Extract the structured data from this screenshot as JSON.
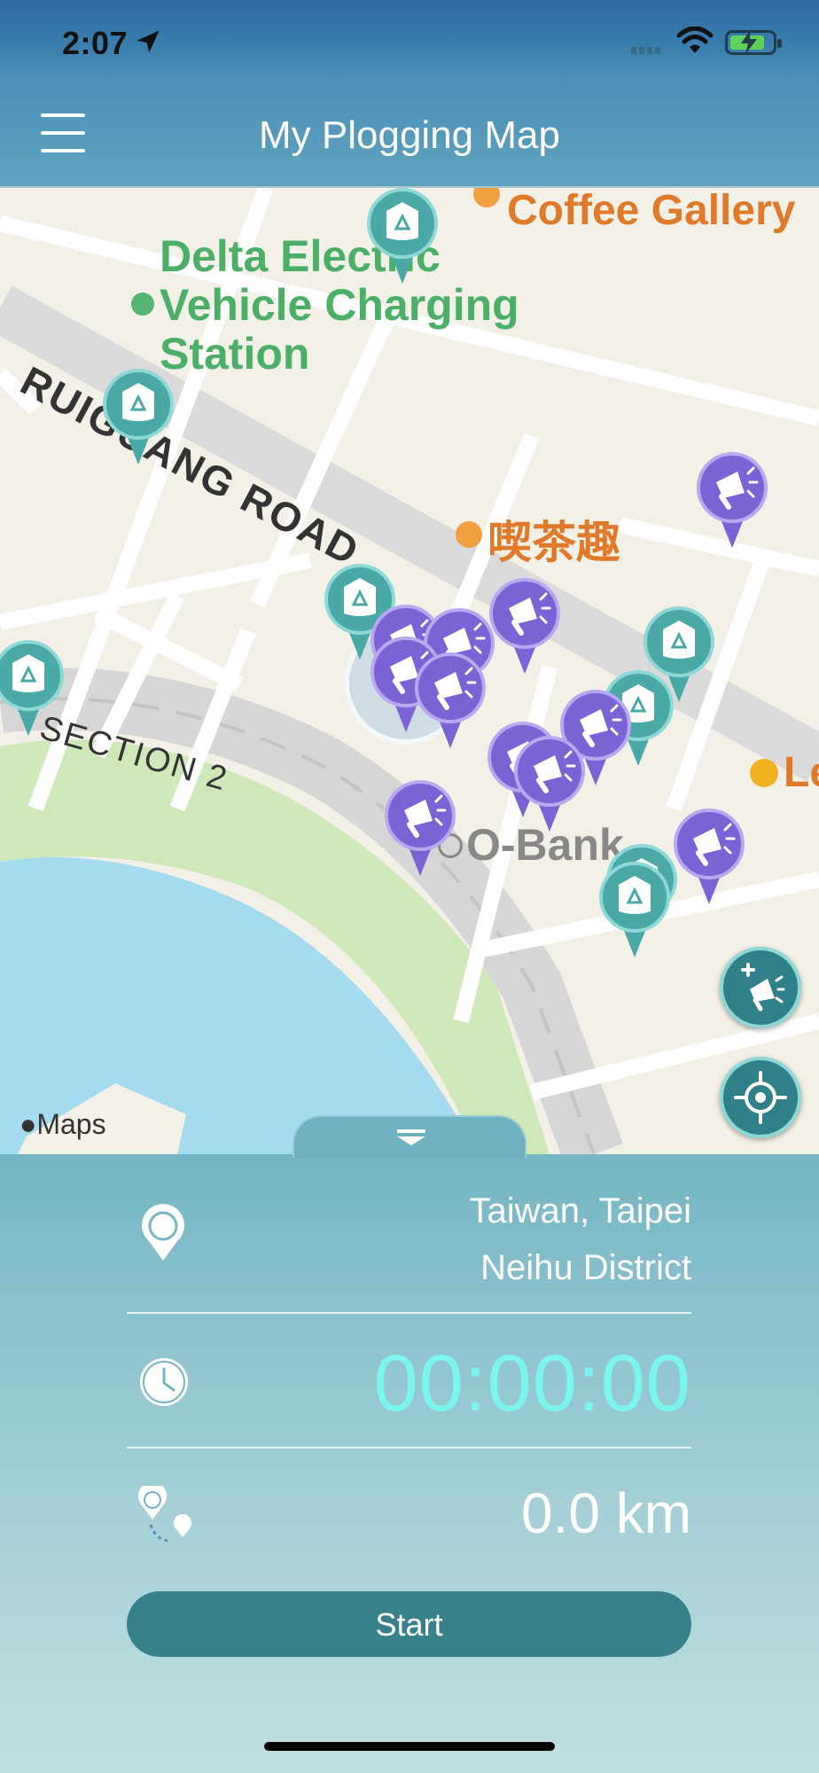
{
  "status_bar": {
    "time": "2:07"
  },
  "nav": {
    "title": "My Plogging Map"
  },
  "map": {
    "labels": {
      "cafe_top": "Coffee Gallery",
      "charging_station": "Delta Electric\nVehicle Charging\nStation",
      "road_main": "RUIGUANG ROAD",
      "road_section": "SECTION 2",
      "tea_shop": "喫茶趣",
      "bank": "O-Bank",
      "partial_label": "Le"
    },
    "attribution": "Maps"
  },
  "panel": {
    "location_line1": "Taiwan, Taipei",
    "location_line2": "Neihu District",
    "timer": "00:00:00",
    "distance": "0.0 km",
    "start_label": "Start"
  },
  "colors": {
    "accent_teal": "#38818b",
    "timer_cyan": "#7cf5ee",
    "marker_recycle": "#4aa9a6",
    "marker_report": "#7b63d6"
  }
}
